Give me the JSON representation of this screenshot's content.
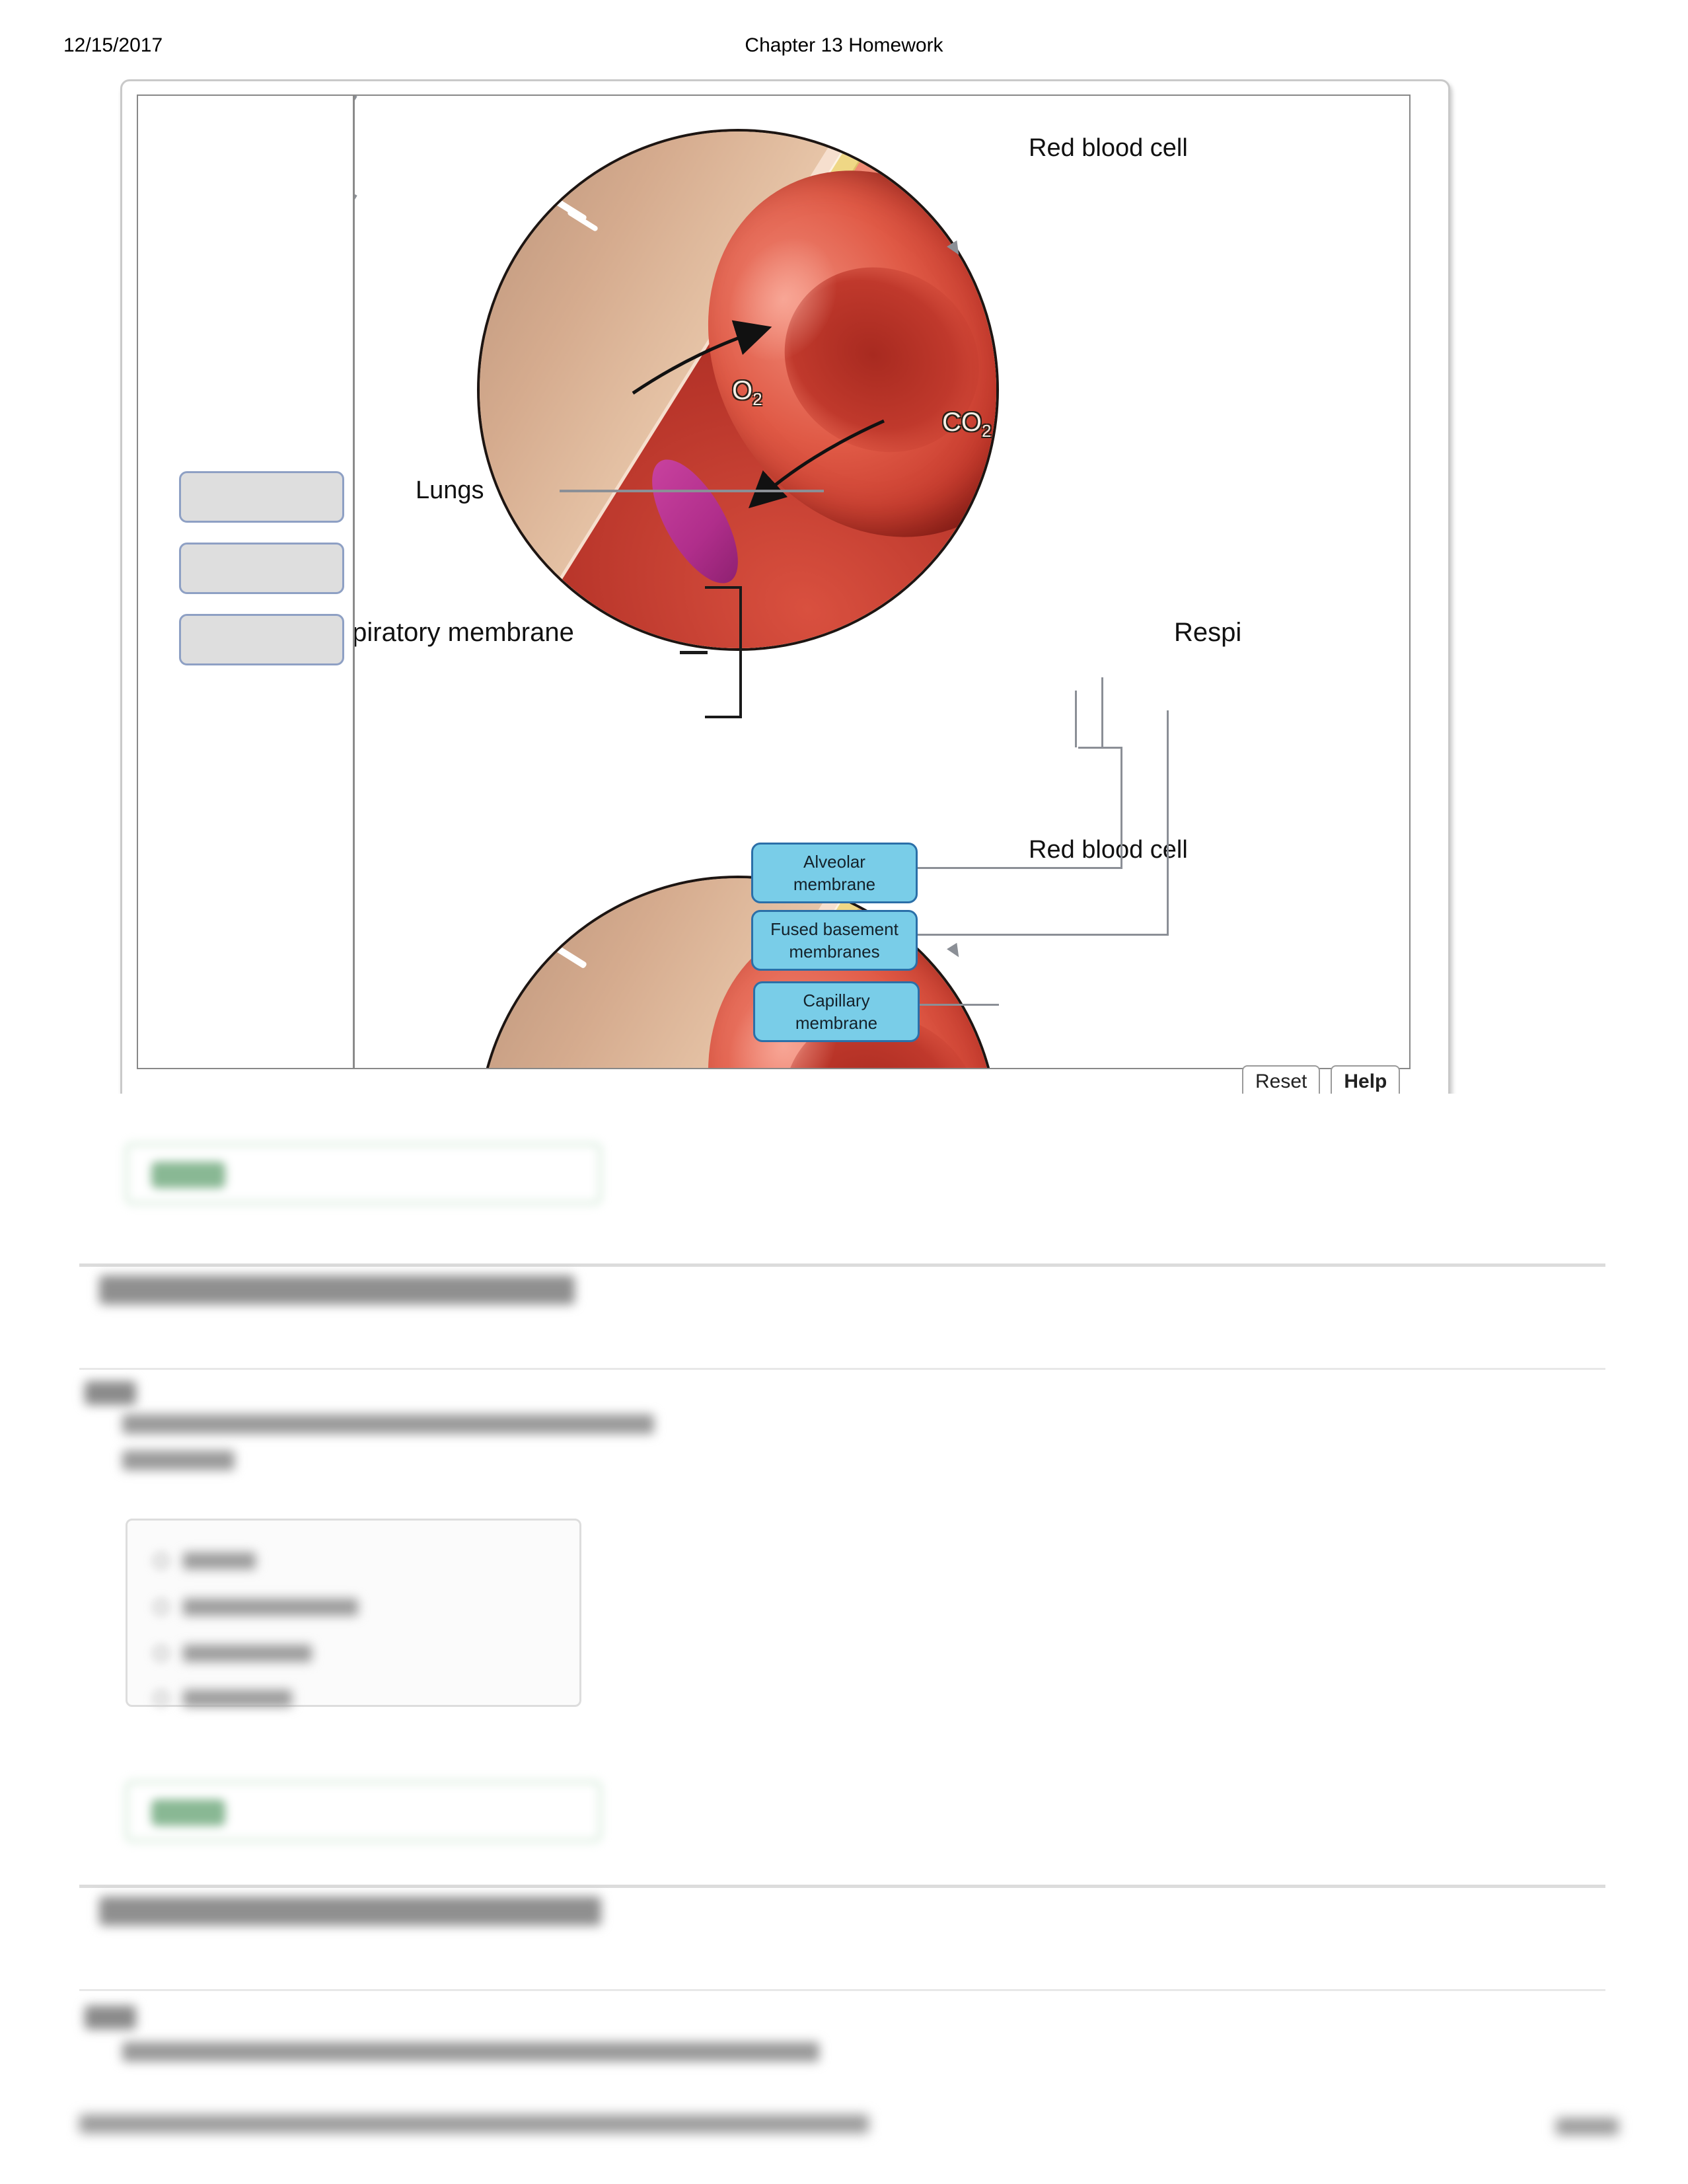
{
  "print_header": {
    "date": "12/15/2017",
    "title": "Chapter 13 Homework"
  },
  "activity": {
    "name": "respiratory-membrane-labeling",
    "drop_targets": [
      {
        "label": ""
      },
      {
        "label": ""
      },
      {
        "label": ""
      }
    ],
    "chips": [
      {
        "label": "Alveolar\nmembrane",
        "line1": "Alveolar",
        "line2": "membrane"
      },
      {
        "label": "Fused basement\nmembranes",
        "line1": "Fused basement",
        "line2": "membranes"
      },
      {
        "label": "Capillary\nmembrane",
        "line1": "Capillary",
        "line2": "membrane"
      }
    ],
    "illustration_labels": {
      "red_blood_cell_top": "Red blood cell",
      "red_blood_cell_bottom": "Red blood cell",
      "lungs": "Lungs",
      "respiratory_membrane": "Respiratory membrane",
      "respiratory_membrane_right_clipped": "Respi",
      "oxygen": "O",
      "oxygen_sub": "2",
      "carbon_dioxide": "CO",
      "carbon_dioxide_sub": "2"
    },
    "buttons": {
      "reset": "Reset",
      "help": "Help"
    },
    "colors": {
      "chip_fill": "#79cde8",
      "chip_border": "#2b6fa8",
      "drop_fill": "#dedede",
      "drop_border": "#8ea0c4",
      "rbc_red": "#c03226",
      "nucleus_magenta": "#b02e8b"
    }
  },
  "feedback": {
    "first": {
      "status": "Correct",
      "redacted": true
    },
    "second": {
      "status": "Correct",
      "redacted": true
    },
    "accent": "#89b894"
  },
  "questions": [
    {
      "heading": "Chapter 13 Chapter Test Question 1",
      "part": "Part A",
      "prompt": "Which of these respiratory organs is located in the neck?",
      "hint": "ANSWER:",
      "choices": [
        "larynx",
        "primary bronchus",
        "alveolar duct",
        "mediastinum"
      ],
      "redacted": true
    },
    {
      "heading": "Chapter 13 Chapter Test Question 2",
      "part": "Part A",
      "prompt": "By which of these are too many particles removed from inhaled surfaces?",
      "redacted": true
    }
  ],
  "footer": {
    "url_line": "https://session.masteringaandp.com/myct/assignmentPrintView?assignmentID=4692432",
    "page_number": "1/10",
    "redacted": true
  }
}
